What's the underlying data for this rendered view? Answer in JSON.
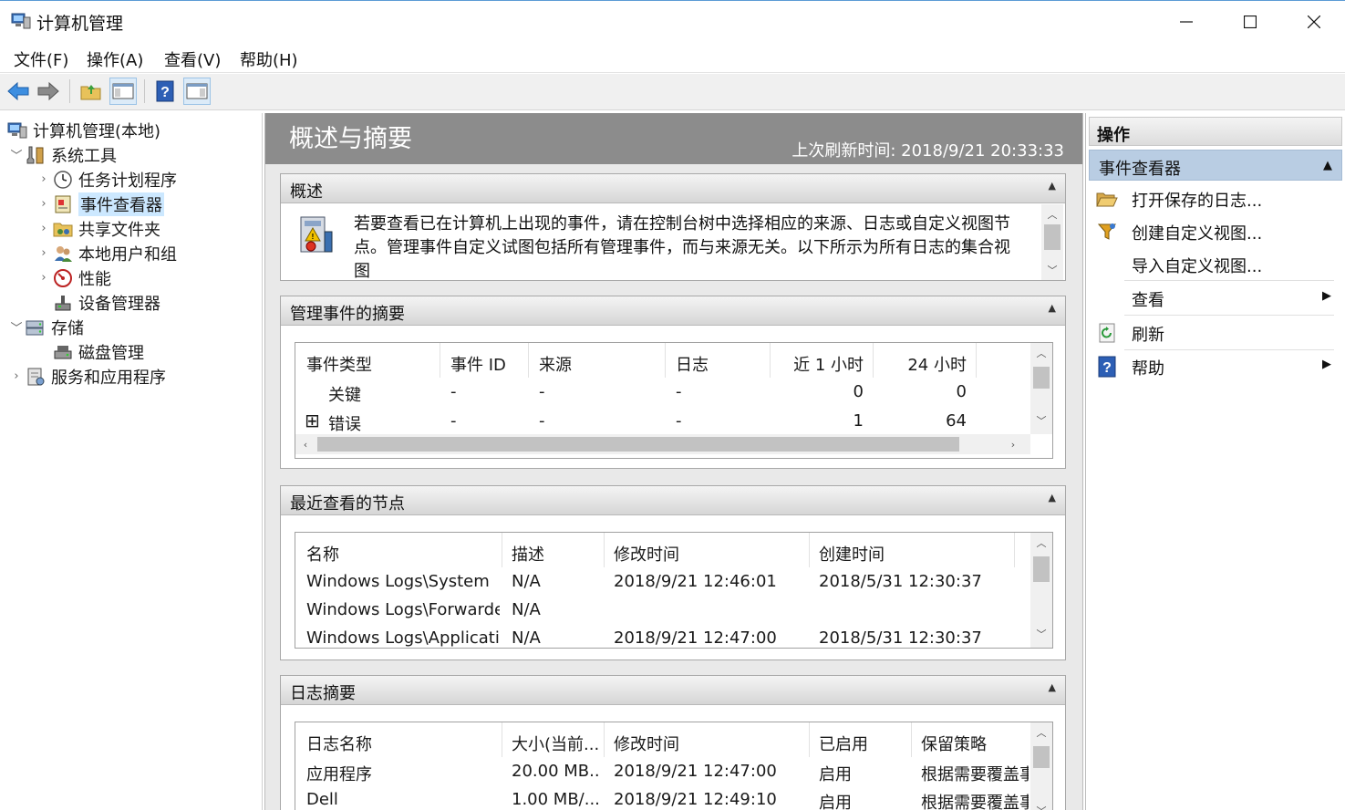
{
  "window": {
    "title": "计算机管理"
  },
  "menu": [
    "文件(F)",
    "操作(A)",
    "查看(V)",
    "帮助(H)"
  ],
  "toolbar": {
    "buttons": [
      "back-icon",
      "forward-icon",
      "up-folder-icon",
      "show-hide-tree-icon",
      "help-icon",
      "show-hide-action-pane-icon"
    ]
  },
  "tree": {
    "root": "计算机管理(本地)",
    "system_tools": "系统工具",
    "task_scheduler": "任务计划程序",
    "event_viewer": "事件查看器",
    "shared_folders": "共享文件夹",
    "local_users": "本地用户和组",
    "performance": "性能",
    "device_manager": "设备管理器",
    "storage": "存储",
    "disk_management": "磁盘管理",
    "services_apps": "服务和应用程序"
  },
  "main": {
    "title": "概述与摘要",
    "refresh_time": "上次刷新时间: 2018/9/21 20:33:33",
    "overview": {
      "header": "概述",
      "text_line1": "若要查看已在计算机上出现的事件，请在控制台树中选择相应的来源、日志或自定义视图节",
      "text_line2": "点。管理事件自定义试图包括所有管理事件，而与来源无关。以下所示为所有日志的集合视",
      "text_line3": "图"
    },
    "admin_summary": {
      "header": "管理事件的摘要",
      "columns": [
        "事件类型",
        "事件 ID",
        "来源",
        "日志",
        "近 1 小时",
        "24 小时"
      ],
      "rows": [
        {
          "expander": "",
          "type": "关键",
          "id": "-",
          "source": "-",
          "log": "-",
          "hour": "0",
          "day": "0"
        },
        {
          "expander": "⊞",
          "type": "错误",
          "id": "-",
          "source": "-",
          "log": "-",
          "hour": "1",
          "day": "64"
        }
      ]
    },
    "recent_nodes": {
      "header": "最近查看的节点",
      "columns": [
        "名称",
        "描述",
        "修改时间",
        "创建时间"
      ],
      "rows": [
        {
          "name": "Windows Logs\\System",
          "desc": "N/A",
          "modified": "2018/9/21 12:46:01",
          "created": "2018/5/31 12:30:37"
        },
        {
          "name": "Windows Logs\\Forwarde...",
          "desc": "N/A",
          "modified": "",
          "created": ""
        },
        {
          "name": "Windows Logs\\Applicati",
          "desc": "N/A",
          "modified": "2018/9/21 12:47:00",
          "created": "2018/5/31 12:30:37"
        }
      ]
    },
    "log_summary": {
      "header": "日志摘要",
      "columns": [
        "日志名称",
        "大小(当前...",
        "修改时间",
        "已启用",
        "保留策略"
      ],
      "rows": [
        {
          "name": "应用程序",
          "size": "20.00 MB...",
          "modified": "2018/9/21 12:47:00",
          "enabled": "启用",
          "policy": "根据需要覆盖事"
        },
        {
          "name": "Dell",
          "size": "1.00 MB/...",
          "modified": "2018/9/21 12:49:10",
          "enabled": "启用",
          "policy": "根据需要覆盖事"
        }
      ]
    }
  },
  "actions": {
    "title": "操作",
    "group": "事件查看器",
    "items": {
      "open_saved": "打开保存的日志...",
      "create_custom": "创建自定义视图...",
      "import_custom": "导入自定义视图...",
      "view": "查看",
      "refresh": "刷新",
      "help": "帮助"
    }
  },
  "colors": {
    "header_gray": "#8c8c8c",
    "selection_blue": "#cce8ff",
    "action_group_blue": "#b9cde3"
  }
}
